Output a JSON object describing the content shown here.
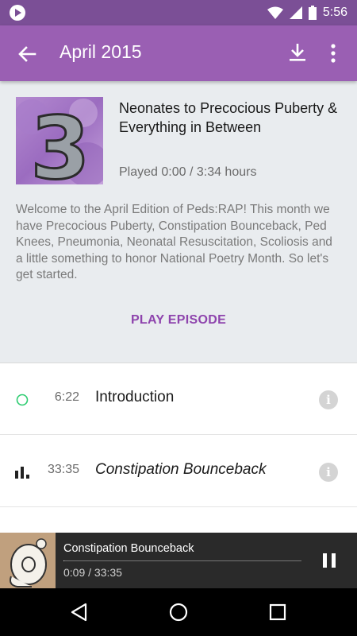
{
  "status_bar": {
    "time": "5:56",
    "icons": [
      "play-badge-icon",
      "wifi-icon",
      "signal-icon",
      "battery-icon"
    ]
  },
  "app_bar": {
    "title": "April 2015",
    "icons": [
      "back-arrow-icon",
      "download-icon",
      "more-vert-icon"
    ]
  },
  "episode": {
    "artwork_numeral": "3",
    "title": "Neonates to Precocious Puberty & Everything in Between",
    "played": "Played 0:00 / 3:34 hours",
    "description": "Welcome to the April Edition of Peds:RAP!  This month we have Precocious Puberty, Constipation Bounceback, Ped Knees, Pneumonia, Neonatal Resuscitation, Scoliosis and a little something to honor National Poetry Month. So let's get started.",
    "play_label": "PLAY EPISODE"
  },
  "chapters": [
    {
      "duration": "6:22",
      "title": "Introduction",
      "status_icon": "unplayed-circle-icon",
      "status_color": "#2ecc71",
      "info_glyph": "i"
    },
    {
      "duration": "33:35",
      "title": "Constipation Bounceback",
      "status_icon": "now-playing-bars-icon",
      "status_color": "#222222",
      "info_glyph": "i"
    }
  ],
  "now_playing": {
    "title": "Constipation Bounceback",
    "time": "0:09 / 33:35",
    "progress_fraction": 0.0045
  },
  "colors": {
    "status_bar": "#7b4f96",
    "app_bar": "#9a5fb3",
    "accent": "#8e44ad",
    "header_bg": "#e9ecef",
    "unplayed": "#2ecc71"
  }
}
